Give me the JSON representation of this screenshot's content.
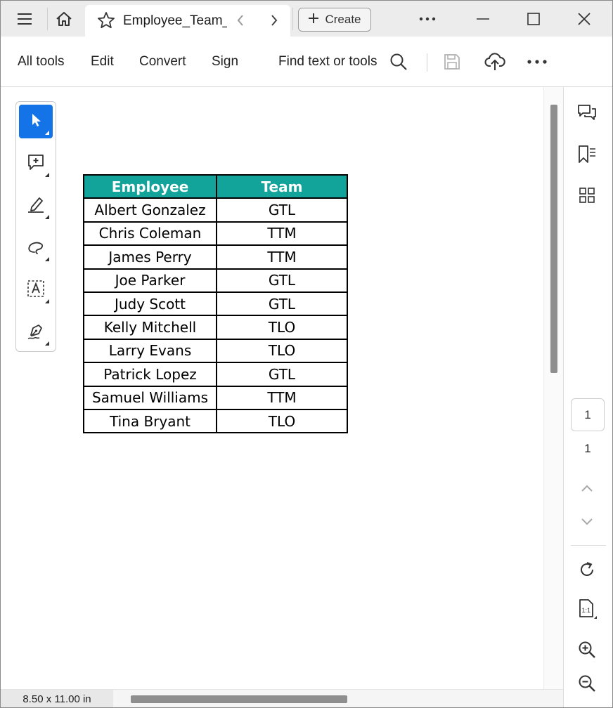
{
  "tabbar": {
    "tab_title": "Employee_Team_",
    "create_label": "Create"
  },
  "menubar": {
    "items": [
      "All tools",
      "Edit",
      "Convert",
      "Sign"
    ],
    "find_label": "Find text or tools"
  },
  "table": {
    "headers": [
      "Employee",
      "Team"
    ],
    "rows": [
      [
        "Albert Gonzalez",
        "GTL"
      ],
      [
        "Chris Coleman",
        "TTM"
      ],
      [
        "James Perry",
        "TTM"
      ],
      [
        "Joe Parker",
        "GTL"
      ],
      [
        "Judy Scott",
        "GTL"
      ],
      [
        "Kelly Mitchell",
        "TLO"
      ],
      [
        "Larry Evans",
        "TLO"
      ],
      [
        "Patrick Lopez",
        "GTL"
      ],
      [
        "Samuel Williams",
        "TTM"
      ],
      [
        "Tina Bryant",
        "TLO"
      ]
    ],
    "header_color": "#12a39a"
  },
  "navigation": {
    "current_page": "1",
    "total_pages": "1"
  },
  "status": {
    "page_size": "8.50 x 11.00 in"
  },
  "colors": {
    "accent": "#1473e6",
    "table_header": "#12a39a"
  },
  "icons": {
    "tabbar": [
      "hamburger-menu-icon",
      "home-icon",
      "star-icon",
      "chevron-left-icon",
      "chevron-right-icon",
      "plus-icon",
      "more-icon",
      "minimize-icon",
      "maximize-icon",
      "close-icon"
    ],
    "toolbar": [
      "search-icon",
      "save-icon",
      "cloud-upload-icon",
      "more-icon"
    ],
    "tools": [
      "select-cursor-icon",
      "add-comment-icon",
      "highlight-icon",
      "draw-icon",
      "text-select-icon",
      "sign-icon"
    ],
    "rail": [
      "comments-icon",
      "bookmarks-icon",
      "thumbnails-icon",
      "chevron-up-icon",
      "chevron-down-icon",
      "refresh-icon",
      "fit-page-icon",
      "zoom-in-icon",
      "zoom-out-icon"
    ]
  }
}
